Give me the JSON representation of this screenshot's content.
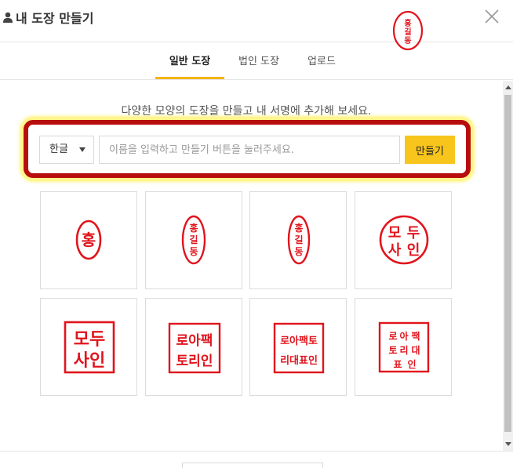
{
  "header": {
    "title": "내 도장 만들기",
    "close_icon": "close-icon",
    "user_icon": "user-icon",
    "preview_stamp_text": "홍길동"
  },
  "tabs": [
    {
      "label": "일반 도장",
      "active": true
    },
    {
      "label": "법인 도장",
      "active": false
    },
    {
      "label": "업로드",
      "active": false
    }
  ],
  "content": {
    "subtitle": "다양한 모양의 도장을 만들고 내 서명에 추가해 보세요."
  },
  "form": {
    "language_selected": "한글",
    "input_placeholder": "이름을 입력하고 만들기 버튼을 눌러주세요.",
    "make_button_label": "만들기"
  },
  "stamps": [
    {
      "style": "oval-single",
      "text": "홍"
    },
    {
      "style": "oval-vertical",
      "text": "홍길동"
    },
    {
      "style": "oval-vertical-2",
      "text": "홍길동"
    },
    {
      "style": "circle-grid",
      "text": "모두사인"
    },
    {
      "style": "square-2x2",
      "lines": [
        "모두",
        "사인"
      ]
    },
    {
      "style": "square-3x2",
      "lines": [
        "로아팩",
        "토리인"
      ]
    },
    {
      "style": "square-4x2",
      "lines": [
        "로아팩토",
        "리대표인"
      ]
    },
    {
      "style": "square-dense",
      "text": "로아팩토리대표인"
    }
  ],
  "colors": {
    "accent": "#f7c51c",
    "tab_underline": "#f5b400",
    "stamp_red": "#e0141c",
    "highlight_border": "#b80d0d",
    "highlight_glow": "#ffe800"
  }
}
